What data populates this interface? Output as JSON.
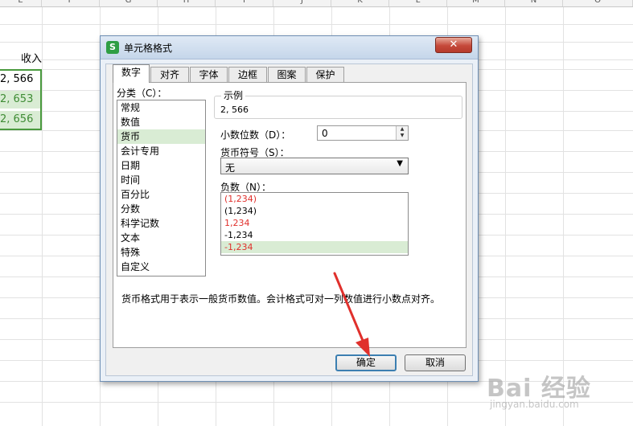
{
  "sheet": {
    "columns": [
      "E",
      "F",
      "G",
      "H",
      "I",
      "J",
      "K",
      "L",
      "M",
      "N",
      "O"
    ],
    "header_text": "收入",
    "values": [
      "2, 566",
      "2, 653",
      "2, 656"
    ]
  },
  "dialog": {
    "title": "单元格格式",
    "app_icon": "S",
    "close_glyph": "✕",
    "tabs": [
      "数字",
      "对齐",
      "字体",
      "边框",
      "图案",
      "保护"
    ],
    "category_label": "分类（C）：",
    "categories": [
      "常规",
      "数值",
      "货币",
      "会计专用",
      "日期",
      "时间",
      "百分比",
      "分数",
      "科学记数",
      "文本",
      "特殊",
      "自定义"
    ],
    "selected_category": "货币",
    "sample_label": "示例",
    "sample_value": "2, 566",
    "decimals_label": "小数位数（D）：",
    "decimals_value": "0",
    "symbol_label": "货币符号（S）：",
    "symbol_value": "无",
    "negative_label": "负数（N）：",
    "negatives": [
      "(1,234)",
      "(1,234)",
      "1,234",
      "-1,234",
      "-1,234"
    ],
    "description": "货币格式用于表示一般货币数值。会计格式可对一列数值进行小数点对齐。",
    "ok_label": "确定",
    "cancel_label": "取消"
  },
  "colors": {
    "negative_red": "#e0302c",
    "accent_green": "#4a9a3e",
    "selection_green": "#d9ecd4",
    "arrow_red": "#e0302c"
  },
  "watermark": {
    "text": "Bai 经验",
    "url": "jingyan.baidu.com"
  }
}
